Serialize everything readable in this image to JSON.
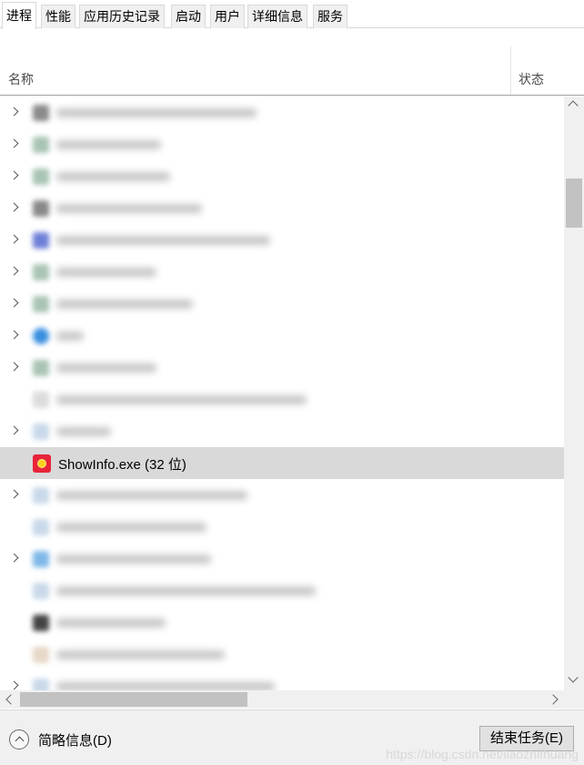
{
  "tabs": [
    {
      "label": "进程",
      "active": true
    },
    {
      "label": "性能"
    },
    {
      "label": "应用历史记录"
    },
    {
      "label": "启动"
    },
    {
      "label": "用户"
    },
    {
      "label": "详细信息"
    },
    {
      "label": "服务"
    }
  ],
  "columns": {
    "name": "名称",
    "status": "状态"
  },
  "process_list": {
    "selected_process": "ShowInfo.exe (32 位)",
    "selected_icon": "showinfo-app-icon",
    "obscured_rows_note": ""
  },
  "footer": {
    "fewer_details": "简略信息(D)",
    "end_task": "结束任务(E)",
    "watermark": "https://blog.csdn.net/liaozhifhuang"
  },
  "colors": {
    "selected_row": "#d9d9d9",
    "app_icon_bg": "#e8243a",
    "app_icon_fg": "#ffd21f"
  }
}
